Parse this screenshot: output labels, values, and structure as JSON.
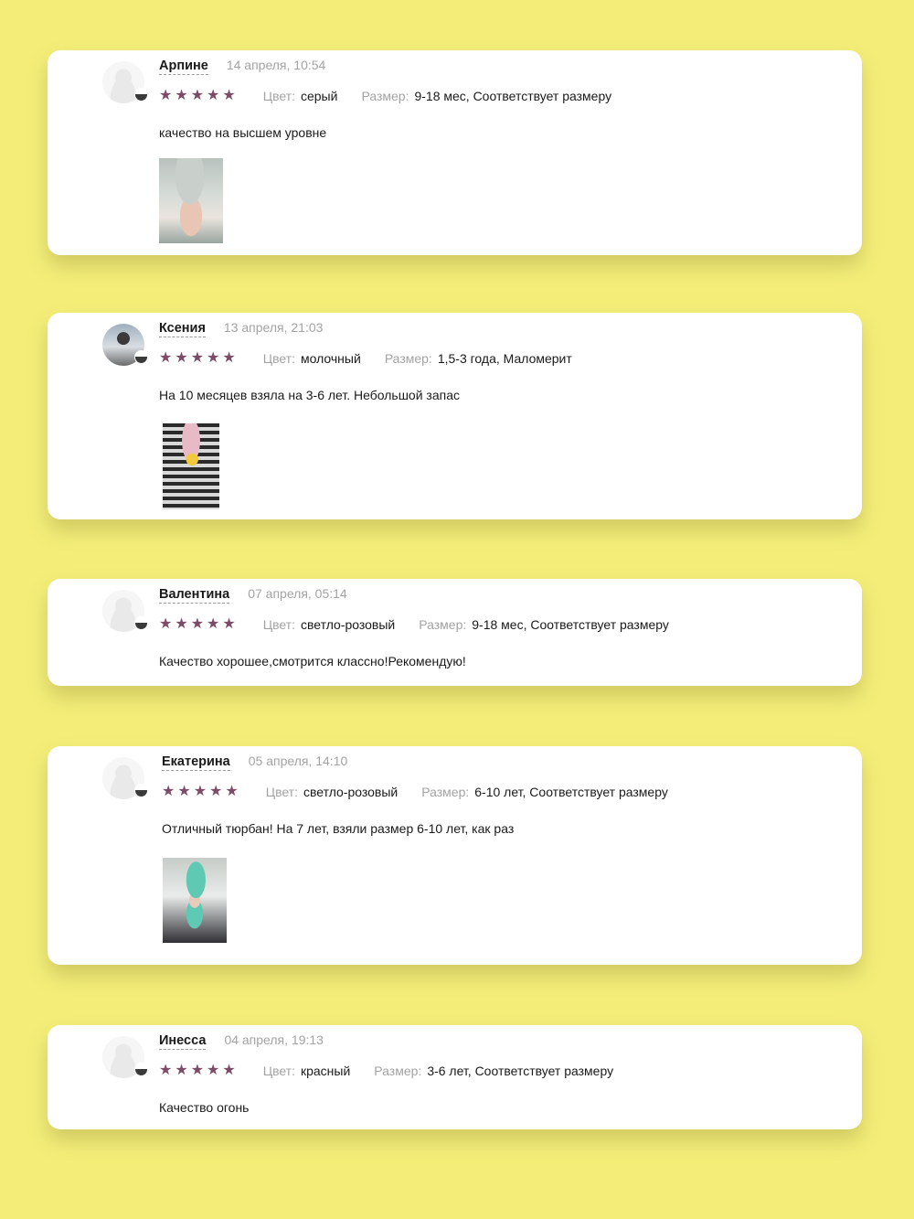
{
  "colors": {
    "background": "#f4ee79",
    "card": "#ffffff",
    "star": "#7c4b66"
  },
  "reviews": [
    {
      "name": "Арпине",
      "date": "14 апреля, 10:54",
      "rating": 5,
      "color_label": "Цвет:",
      "color_value": "серый",
      "size_label": "Размер:",
      "size_value": "9-18 мес, Соответствует размеру",
      "text": "качество на высшем уровне",
      "has_photo": true
    },
    {
      "name": "Ксения",
      "date": "13 апреля, 21:03",
      "rating": 5,
      "color_label": "Цвет:",
      "color_value": "молочный",
      "size_label": "Размер:",
      "size_value": "1,5-3 года, Маломерит",
      "text": "На 10 месяцев взяла на 3-6 лет. Небольшой запас",
      "has_photo": true
    },
    {
      "name": "Валентина",
      "date": "07 апреля, 05:14",
      "rating": 5,
      "color_label": "Цвет:",
      "color_value": "светло-розовый",
      "size_label": "Размер:",
      "size_value": "9-18 мес, Соответствует размеру",
      "text": "Качество хорошее,смотрится классно!Рекомендую!",
      "has_photo": false
    },
    {
      "name": "Екатерина",
      "date": "05 апреля, 14:10",
      "rating": 5,
      "color_label": "Цвет:",
      "color_value": "светло-розовый",
      "size_label": "Размер:",
      "size_value": "6-10 лет, Соответствует размеру",
      "text": "Отличный тюрбан! На 7 лет, взяли размер 6-10 лет, как раз",
      "has_photo": true
    },
    {
      "name": "Инесса",
      "date": "04 апреля, 19:13",
      "rating": 5,
      "color_label": "Цвет:",
      "color_value": "красный",
      "size_label": "Размер:",
      "size_value": "3-6 лет, Соответствует размеру",
      "text": "Качество огонь",
      "has_photo": false
    }
  ]
}
